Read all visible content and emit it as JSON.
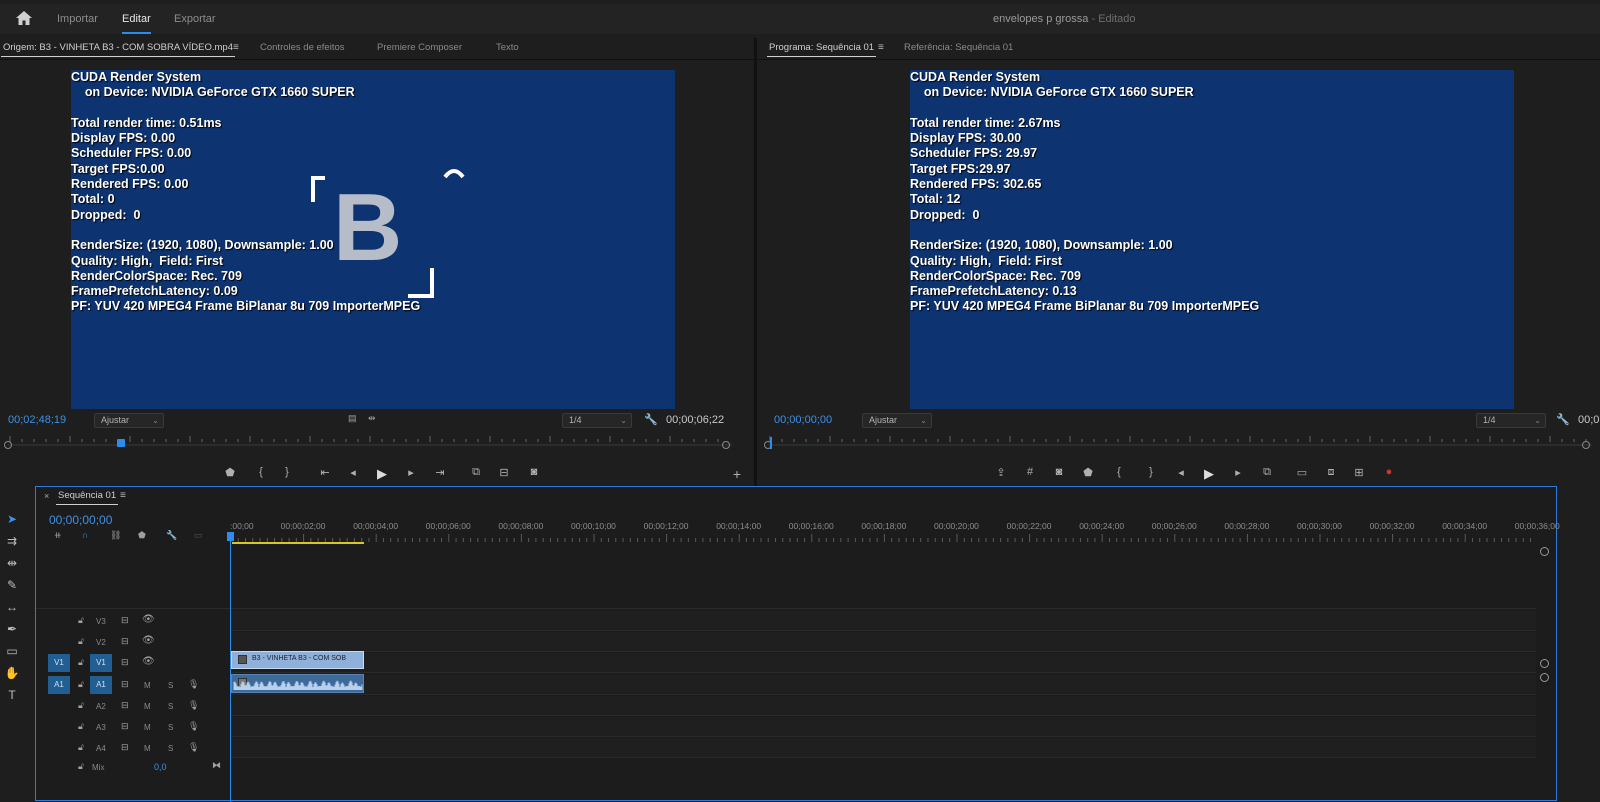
{
  "topbar": {
    "nav": [
      "Importar",
      "Editar",
      "Exportar"
    ],
    "active_nav": "Editar",
    "document_title": "envelopes p grossa",
    "document_status": "- Editado"
  },
  "source_panel": {
    "tabs": [
      "Origem: B3 - VINHETA B3  - COM SOBRA VÍDEO.mp4",
      "Controles de efeitos",
      "Premiere Composer",
      "Texto"
    ],
    "screen_lines": [
      "CUDA Render System",
      "    on Device: NVIDIA GeForce GTX 1660 SUPER",
      "",
      "Total render time: 0.51ms",
      "Display FPS: 0.00",
      "Scheduler FPS: 0.00",
      "Target FPS:0.00",
      "Rendered FPS: 0.00",
      "Total: 0",
      "Dropped:  0",
      "",
      "RenderSize: (1920, 1080), Downsample: 1.00",
      "Quality: High,  Field: First",
      "RenderColorSpace: Rec. 709",
      "FramePrefetchLatency: 0.09",
      "PF: YUV 420 MPEG4 Frame BiPlanar 8u 709 ImporterMPEG"
    ],
    "logo_letter": "B",
    "timecode": "00;02;48;19",
    "fit": "Ajustar",
    "resolution": "1/4",
    "duration": "00;00;06;22",
    "playhead_fraction": 0.15
  },
  "program_panel": {
    "tabs": [
      "Programa: Sequência 01",
      "Referência: Sequência 01"
    ],
    "screen_lines": [
      "CUDA Render System",
      "    on Device: NVIDIA GeForce GTX 1660 SUPER",
      "",
      "Total render time: 2.67ms",
      "Display FPS: 30.00",
      "Scheduler FPS: 29.97",
      "Target FPS:29.97",
      "Rendered FPS: 302.65",
      "Total: 12",
      "Dropped:  0",
      "",
      "RenderSize: (1920, 1080), Downsample: 1.00",
      "Quality: High,  Field: First",
      "RenderColorSpace: Rec. 709",
      "FramePrefetchLatency: 0.13",
      "PF: YUV 420 MPEG4 Frame BiPlanar 8u 709 ImporterMPEG"
    ],
    "timecode": "00;00;00;00",
    "fit": "Ajustar",
    "resolution": "1/4",
    "duration_partial": "00;0"
  },
  "timeline": {
    "sequence_name": "Sequência 01",
    "timecode": "00;00;00;00",
    "ruler_labels": [
      ":00;00",
      "00;00;02;00",
      "00;00;04;00",
      "00;00;06;00",
      "00;00;08;00",
      "00;00;10;00",
      "00;00;12;00",
      "00;00;14;00",
      "00;00;16;00",
      "00;00;18;00",
      "00;00;20;00",
      "00;00;22;00",
      "00;00;24;00",
      "00;00;26;00",
      "00;00;28;00",
      "00;00;30;00",
      "00;00;32;00",
      "00;00;34;00",
      "00;00;36;00"
    ],
    "video_tracks": [
      {
        "src": "",
        "name": "V3"
      },
      {
        "src": "",
        "name": "V2"
      },
      {
        "src": "V1",
        "name": "V1"
      }
    ],
    "audio_tracks": [
      {
        "src": "A1",
        "name": "A1",
        "m": "M",
        "s": "S"
      },
      {
        "src": "",
        "name": "A2",
        "m": "M",
        "s": "S"
      },
      {
        "src": "",
        "name": "A3",
        "m": "M",
        "s": "S"
      },
      {
        "src": "",
        "name": "A4",
        "m": "M",
        "s": "S"
      }
    ],
    "mix_label": "Mix",
    "mix_value": "0,0",
    "video_clip_label": "B3 - VINHETA B3  - COM SOB",
    "colors": {
      "accent": "#2d8ceb",
      "clip_video": "#8fb0d8",
      "clip_audio": "#3e6a9a",
      "work_area": "#d6c81f"
    }
  }
}
